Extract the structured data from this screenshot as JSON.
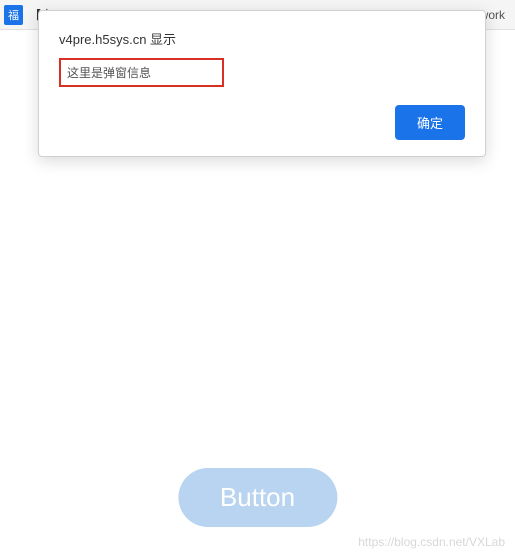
{
  "topbar": {
    "badge_text": "福",
    "left_text": "【家",
    "right_text": "work"
  },
  "dialog": {
    "title": "v4pre.h5sys.cn 显示",
    "message": "这里是弹窗信息",
    "ok_label": "确定"
  },
  "main": {
    "button_label": "Button"
  },
  "watermark": {
    "text": "https://blog.csdn.net/VXLab"
  }
}
